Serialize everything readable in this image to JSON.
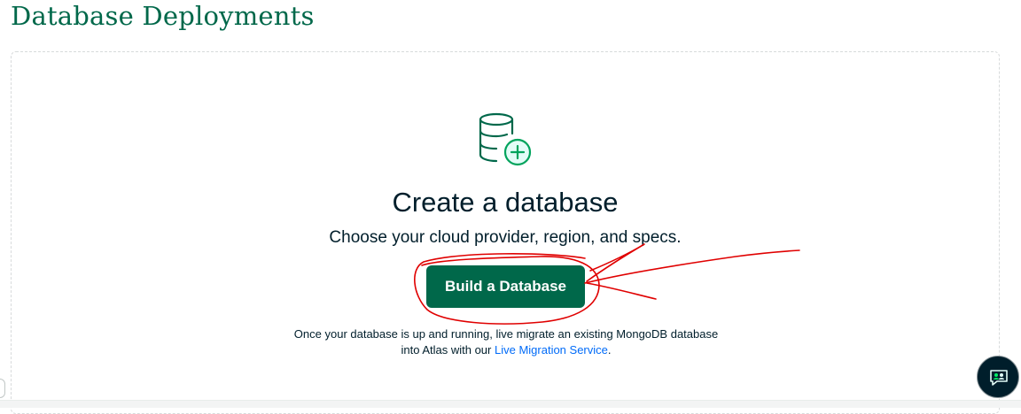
{
  "page": {
    "title": "Database Deployments"
  },
  "empty_state": {
    "icon": "database-add-icon",
    "heading": "Create a database",
    "subheading": "Choose your cloud provider, region, and specs.",
    "build_button_label": "Build a Database",
    "migration_note_prefix": "Once your database is up and running, live migrate an existing MongoDB database",
    "migration_note_line2_prefix": "into Atlas with our ",
    "migration_link_label": "Live Migration Service",
    "migration_note_suffix": "."
  },
  "chat": {
    "icon": "chat-support-icon"
  },
  "annotation": {
    "type": "red-freehand-circle-and-arrow",
    "color": "#e00000"
  },
  "colors": {
    "brand_green": "#00684a",
    "accent_green": "#00ed64",
    "link_blue": "#016bf8",
    "text_dark": "#001e2b"
  }
}
